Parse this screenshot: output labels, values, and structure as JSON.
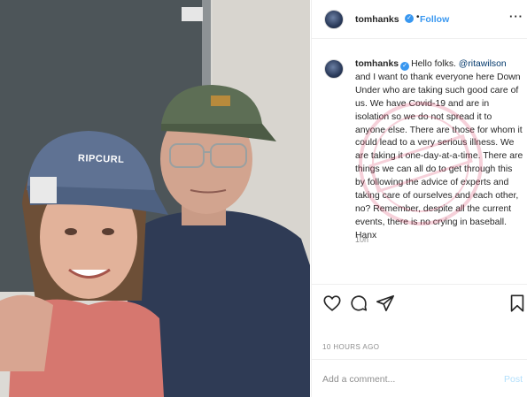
{
  "header": {
    "username": "tomhanks",
    "verified_icon": "verified-badge-icon",
    "separator": "•",
    "follow_label": "Follow",
    "more_label": "···"
  },
  "photo": {
    "cap_left_text": "RIPCURL",
    "description_icon": "photo"
  },
  "comment": {
    "username": "tomhanks",
    "intro": "Hello folks. ",
    "mention": "@ritawilson",
    "body": " and I want to thank everyone here Down Under who are taking such good care of us. We have Covid-19 and are in isolation so we do not spread it to anyone else. There are those for whom it could lead to a very serious illness. We are taking it one-day-at-a-time. There are things we can all do to get through this by following the advice of experts and taking care of ourselves and each other, no? Remember, despite all the current events, there is no crying in baseball. Hanx",
    "time_ago": "10h"
  },
  "actions": {
    "like_icon": "heart-icon",
    "comment_icon": "comment-icon",
    "share_icon": "share-icon",
    "save_icon": "bookmark-icon"
  },
  "timestamp": "10 HOURS AGO",
  "add_comment": {
    "placeholder": "Add a comment...",
    "post_label": "Post"
  },
  "colors": {
    "follow_blue": "#3897f0",
    "post_disabled": "#b2dffc",
    "muted_text": "#8e8e8e"
  }
}
